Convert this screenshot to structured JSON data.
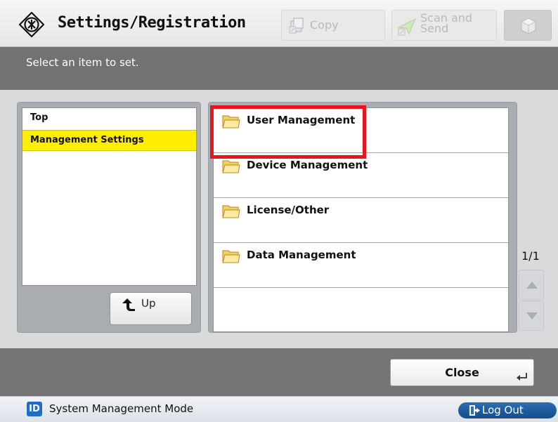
{
  "header": {
    "title": "Settings/Registration",
    "icon": "settings-gear-icon",
    "copy_label": "Copy",
    "scan_label_line1": "Scan and",
    "scan_label_line2": "Send",
    "home_icon": "home-cube-icon"
  },
  "instruction": "Select an item to set.",
  "tree": {
    "items": [
      {
        "label": "Top",
        "selected": false
      },
      {
        "label": "Management Settings",
        "selected": true
      }
    ],
    "up_label": "Up"
  },
  "list": {
    "items": [
      {
        "label": "User Management",
        "icon": "folder-icon",
        "highlighted": true
      },
      {
        "label": "Device Management",
        "icon": "folder-icon"
      },
      {
        "label": "License/Other",
        "icon": "folder-icon"
      },
      {
        "label": "Data Management",
        "icon": "folder-icon"
      }
    ]
  },
  "pager": {
    "page_indicator": "1/1"
  },
  "footer": {
    "close_label": "Close"
  },
  "status": {
    "id_badge": "ID",
    "mode_label": "System Management Mode",
    "logout_label": "Log Out"
  },
  "colors": {
    "selected_row": "#ffee00",
    "highlight_box": "#e8151c",
    "instruction_bar": "#727273",
    "logout_button": "#1f5fa0"
  }
}
